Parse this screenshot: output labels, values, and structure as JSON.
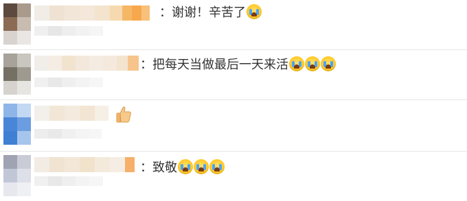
{
  "comments": [
    {
      "separator": "：",
      "text": "谢谢！辛苦了",
      "emoji": [
        "crying-face"
      ]
    },
    {
      "separator": "：",
      "text": "把每天当做最后一天来活",
      "emoji": [
        "crying-face",
        "crying-face",
        "crying-face"
      ]
    },
    {
      "separator": "",
      "text": "",
      "emoji": [
        "thumbs-up"
      ]
    },
    {
      "separator": "：",
      "text": "致敬",
      "emoji": [
        "crying-face",
        "crying-face",
        "crying-face"
      ]
    }
  ],
  "colors": {
    "divider": "#e6e6e6",
    "text": "#333333",
    "blur": "#f0e4d2",
    "accent": "#f5a24a"
  }
}
